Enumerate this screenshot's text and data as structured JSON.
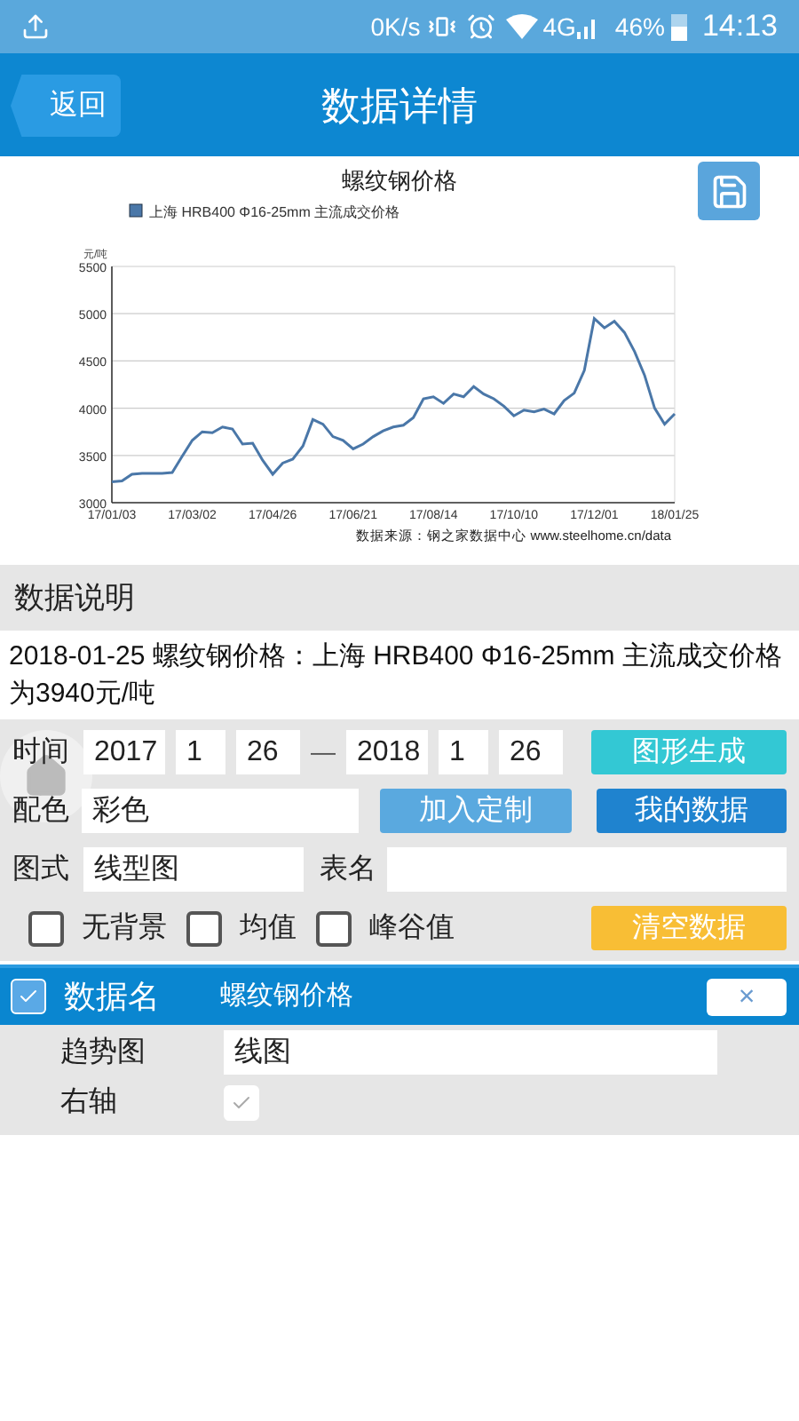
{
  "status_bar": {
    "speed": "0K/s",
    "network": "4G",
    "battery": "46%",
    "time": "14:13"
  },
  "header": {
    "back": "返回",
    "title": "数据详情"
  },
  "chart_data": {
    "type": "line",
    "title": "螺纹钢价格",
    "ylabel": "元/吨",
    "categories": [
      "17/01/03",
      null,
      null,
      null,
      null,
      null,
      null,
      null,
      "17/03/02",
      null,
      null,
      null,
      null,
      null,
      null,
      null,
      "17/04/26",
      null,
      null,
      null,
      null,
      null,
      null,
      null,
      "17/06/21",
      null,
      null,
      null,
      null,
      null,
      null,
      null,
      "17/08/14",
      null,
      null,
      null,
      null,
      null,
      null,
      null,
      "17/10/10",
      null,
      null,
      null,
      null,
      null,
      null,
      null,
      "17/12/01",
      null,
      null,
      null,
      null,
      null,
      null,
      null,
      "18/01/25"
    ],
    "series": [
      {
        "name": "上海 HRB400 Φ16-25mm 主流成交价格",
        "color": "#4a77a8",
        "values": [
          3220,
          3230,
          3300,
          3310,
          3310,
          3310,
          3320,
          3490,
          3660,
          3750,
          3740,
          3800,
          3780,
          3620,
          3630,
          3450,
          3300,
          3420,
          3460,
          3600,
          3880,
          3830,
          3700,
          3660,
          3570,
          3620,
          3700,
          3760,
          3800,
          3820,
          3900,
          4100,
          4120,
          4050,
          4150,
          4120,
          4230,
          4150,
          4100,
          4020,
          3920,
          3980,
          3960,
          3990,
          3940,
          4080,
          4160,
          4400,
          4950,
          4850,
          4920,
          4800,
          4600,
          4350,
          4000,
          3830,
          3940
        ]
      }
    ],
    "ylim": [
      3000,
      5500
    ],
    "grid": true,
    "yticks": [
      3000,
      3500,
      4000,
      4500,
      5000,
      5500
    ],
    "annotations": [
      "数据来源：钢之家数据中心 www.steelhome.cn/data"
    ]
  },
  "description": {
    "heading": "数据说明",
    "text": "2018-01-25 螺纹钢价格：上海 HRB400 Φ16-25mm 主流成交价格为3940元/吨"
  },
  "form": {
    "time_label": "时间",
    "start": [
      "2017",
      "1",
      "26"
    ],
    "dash": "—",
    "end": [
      "2018",
      "1",
      "26"
    ],
    "generate": "图形生成",
    "color_label": "配色",
    "color_value": "彩色",
    "add_custom": "加入定制",
    "my_data": "我的数据",
    "style_label": "图式",
    "style_value": "线型图",
    "table_name_label": "表名",
    "options": [
      {
        "label": "无背景",
        "checked": false
      },
      {
        "label": "均值",
        "checked": false
      },
      {
        "label": "峰谷值",
        "checked": false
      }
    ],
    "clear": "清空数据"
  },
  "series_panel": {
    "checked": true,
    "label": "数据名",
    "name": "螺纹钢价格",
    "close": "×",
    "trend_label": "趋势图",
    "trend_value": "线图",
    "right_axis_label": "右轴",
    "right_axis": true
  }
}
